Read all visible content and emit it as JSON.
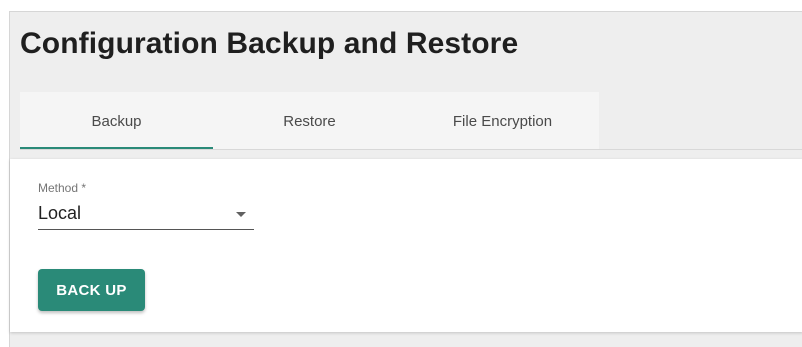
{
  "page": {
    "title": "Configuration Backup and Restore"
  },
  "tabs": [
    {
      "label": "Backup",
      "active": true
    },
    {
      "label": "Restore",
      "active": false
    },
    {
      "label": "File Encryption",
      "active": false
    }
  ],
  "form": {
    "method": {
      "label": "Method *",
      "value": "Local"
    },
    "backup_button_label": "BACK UP"
  },
  "colors": {
    "accent": "#2a8a78",
    "background": "#eeeeee",
    "card": "#ffffff"
  }
}
